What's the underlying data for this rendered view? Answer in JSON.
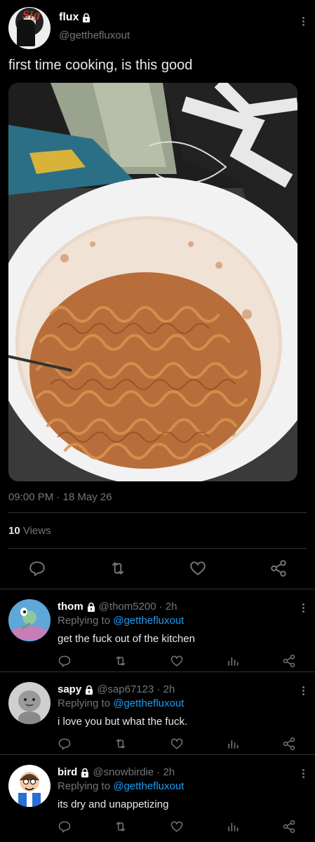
{
  "tweet": {
    "author_name": "flux",
    "author_handle": "@getthefluxout",
    "text": "first time cooking, is this good",
    "timestamp": "09:00 PM · 18 May 26",
    "views_count": "10",
    "views_label": "Views",
    "image_alt": "plate of instant noodles"
  },
  "replies": [
    {
      "name": "thom",
      "handle": "@thom5200",
      "time": "· 2h",
      "replying_prefix": "Replying to",
      "replying_to": "@getthefluxout",
      "text": "get the fuck out of the kitchen"
    },
    {
      "name": "sapy",
      "handle": "@sap67123",
      "time": "· 2h",
      "replying_prefix": "Replying to",
      "replying_to": "@getthefluxout",
      "text": "i love you but what the fuck."
    },
    {
      "name": "bird",
      "handle": "@snowbirdie",
      "time": "· 2h",
      "replying_prefix": "Replying to",
      "replying_to": "@getthefluxout",
      "text": "its dry and unappetizing"
    }
  ],
  "icons": [
    "lock-icon",
    "more-icon",
    "reply-icon",
    "retweet-icon",
    "like-icon",
    "share-icon",
    "analytics-icon"
  ],
  "colors": {
    "background": "#000000",
    "text": "#e7e9ea",
    "muted": "#71767b",
    "link": "#1d9bf0",
    "divider": "#2f3336"
  }
}
